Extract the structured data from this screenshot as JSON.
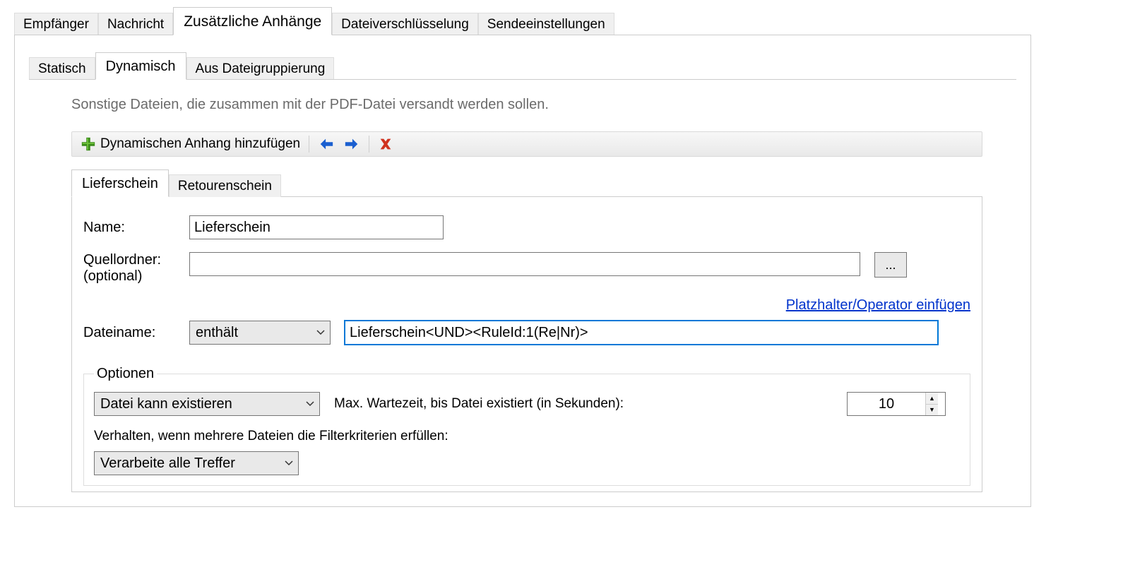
{
  "mainTabs": {
    "t0": "Empfänger",
    "t1": "Nachricht",
    "t2": "Zusätzliche Anhänge",
    "t3": "Dateiverschlüsselung",
    "t4": "Sendeeinstellungen"
  },
  "subTabs": {
    "s0": "Statisch",
    "s1": "Dynamisch",
    "s2": "Aus Dateigruppierung"
  },
  "info": "Sonstige Dateien, die zusammen mit der PDF-Datei versandt werden sollen.",
  "toolbar": {
    "addLabel": "Dynamischen Anhang hinzufügen"
  },
  "attachTabs": {
    "a0": "Lieferschein",
    "a1": "Retourenschein"
  },
  "labels": {
    "name": "Name:",
    "srcFolder1": "Quellordner:",
    "srcFolder2": "(optional)",
    "filename": "Dateiname:",
    "browse": "...",
    "insertPlaceholder": "Platzhalter/Operator einfügen",
    "options": "Optionen",
    "maxWait": "Max. Wartezeit, bis Datei existiert (in Sekunden):",
    "multiBehavior": "Verhalten, wenn mehrere Dateien die Filterkriterien erfüllen:"
  },
  "values": {
    "name": "Lieferschein",
    "srcFolder": "",
    "matchMode": "enthält",
    "filename": "Lieferschein<UND><RuleId:1(Re|Nr)>",
    "existence": "Datei kann existieren",
    "maxWait": "10",
    "multiBehavior": "Verarbeite alle Treffer"
  }
}
